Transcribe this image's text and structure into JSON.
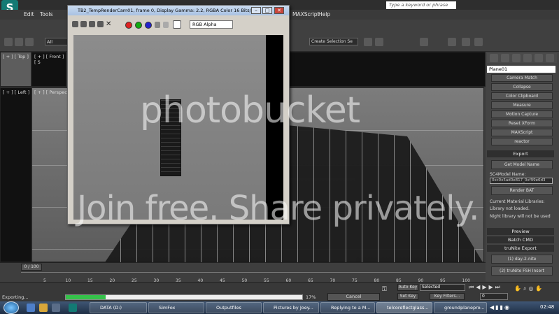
{
  "menu": {
    "edit": "Edit",
    "tools": "Tools",
    "maxscript": "MAXScript",
    "help": "Help"
  },
  "search": {
    "placeholder": "Type a keyword or phrase"
  },
  "toolbar": {
    "selection_filter": "All",
    "selection_set": "Create Selection Se"
  },
  "viewports": {
    "top": "[ + ] [ Top ]",
    "front": "[ + ] [ Front ] [ S",
    "left": "[ + ] [ Left ]",
    "perspective": "[ + ] [ Perspective"
  },
  "render_window": {
    "title": "TB2_TempRenderCam01, frame 0, Display Gamma: 2.2, RGBA Color 16 Bits/C...",
    "channel": "RGB Alpha",
    "minimize": "–",
    "restore": "□",
    "close": "✕"
  },
  "command_panel": {
    "object_name": "Plane01",
    "utilities": [
      "Camera Match",
      "Collapse",
      "Color Clipboard",
      "Measure",
      "Motion Capture",
      "Reset XForm",
      "MAXScript",
      "reactor"
    ],
    "export_rollout": "Export",
    "get_model_name": "Get Model Name",
    "sc4_model_name_label": "SC4Model Name:",
    "sc4_model_name_value": "0xc0x5ad0e817_0xf99e6d3",
    "render_bat": "Render BAT",
    "materials_label": "Current Material Libraries:",
    "library_status": "Library not loaded.",
    "night_library": "Night library will not be used",
    "preview": "Preview",
    "batch_cmd": "Batch CMD",
    "trunite_export": "truNite Export",
    "day2nite": "(1) day-2-nite",
    "fsh_insert": "(2) truNite FSH Insert"
  },
  "timeline": {
    "frame": "0 / 100",
    "ticks": [
      "5",
      "10",
      "15",
      "20",
      "25",
      "30",
      "35",
      "40",
      "45",
      "50",
      "55",
      "60",
      "65",
      "70",
      "75",
      "80",
      "85",
      "90",
      "95",
      "100"
    ]
  },
  "status": {
    "exporting": "Exporting...",
    "percent": "17%",
    "progress": 0.17,
    "cancel": "Cancel",
    "auto_key": "Auto Key",
    "selected": "Selected",
    "set_key": "Set Key",
    "key_filters": "Key Filters...",
    "frame_value": "0"
  },
  "watermark": {
    "line1": "photobucket",
    "line2": "Join free. Share privately."
  },
  "taskbar": {
    "items": [
      "DATA (D:)",
      "SimFox",
      "Outputfiles",
      "Pictures by Joey...",
      "Replying to a M...",
      "telcoreflectglass...",
      "groundplanepro..."
    ],
    "clock": "02:48"
  },
  "colors": {
    "accent": "#137a74",
    "progress": "#35c24a",
    "titlebar": "#a9c2e3"
  }
}
